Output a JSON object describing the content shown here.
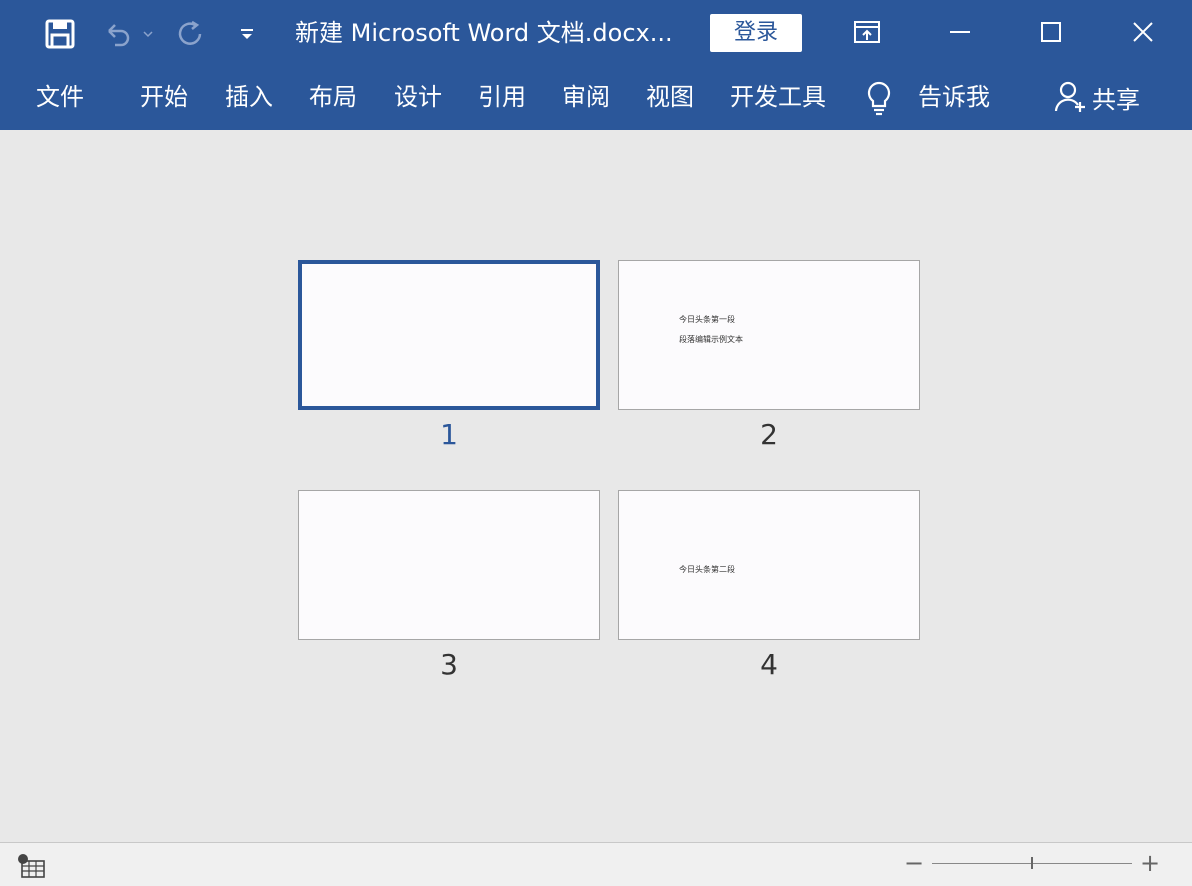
{
  "titlebar": {
    "document_title": "新建 Microsoft Word 文档.docx...",
    "login_label": "登录",
    "icons": [
      "save-icon",
      "undo-icon",
      "undo-dropdown-icon",
      "redo-icon",
      "customize-qat-icon",
      "ribbon-display-options-icon",
      "minimize-icon",
      "maximize-icon",
      "close-icon"
    ]
  },
  "ribbon": {
    "tabs": [
      "文件",
      "开始",
      "插入",
      "布局",
      "设计",
      "引用",
      "审阅",
      "视图",
      "开发工具"
    ],
    "tell_me_label": "告诉我",
    "share_label": "共享"
  },
  "pages": [
    {
      "number": "1",
      "selected": true,
      "lines": []
    },
    {
      "number": "2",
      "selected": false,
      "lines": [
        "今日头条第一段",
        "段落编辑示例文本"
      ]
    },
    {
      "number": "3",
      "selected": false,
      "lines": []
    },
    {
      "number": "4",
      "selected": false,
      "lines": [
        "今日头条第二段"
      ]
    }
  ],
  "statusbar": {
    "zoom_minus": "−",
    "zoom_plus": "+",
    "zoom_level": 0.5
  },
  "colors": {
    "accent": "#2b579a",
    "canvas": "#e8e8e8"
  }
}
